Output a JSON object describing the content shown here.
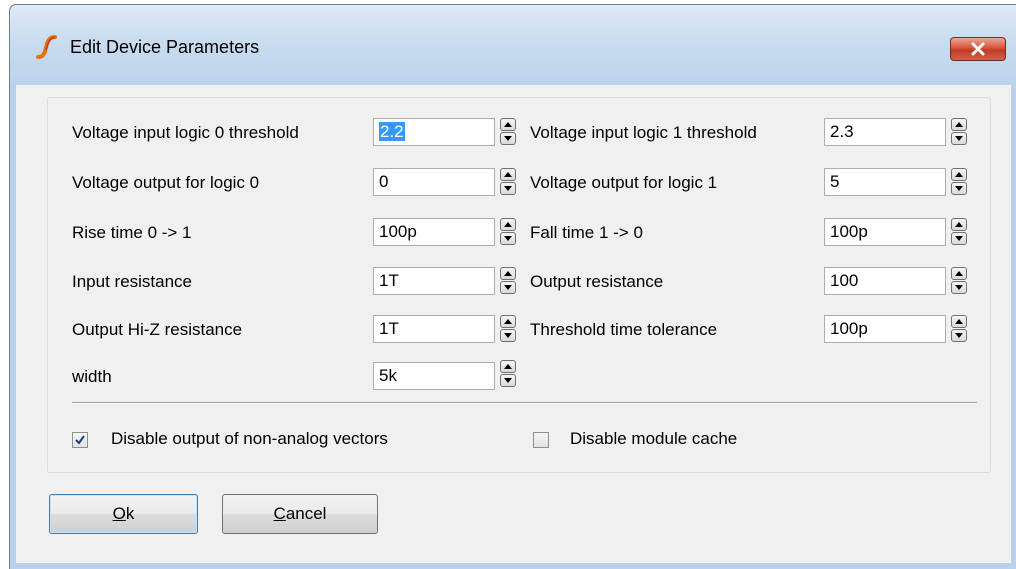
{
  "window": {
    "title": "Edit Device Parameters"
  },
  "params": {
    "left": [
      {
        "label": "Voltage input logic 0 threshold",
        "value": "2.2",
        "selected": true
      },
      {
        "label": "Voltage output for logic 0",
        "value": "0"
      },
      {
        "label": "Rise time 0 -> 1",
        "value": "100p"
      },
      {
        "label": "Input resistance",
        "value": "1T"
      },
      {
        "label": "Output Hi-Z resistance",
        "value": "1T"
      },
      {
        "label": "width",
        "value": "5k"
      }
    ],
    "right": [
      {
        "label": "Voltage input logic 1 threshold",
        "value": "2.3"
      },
      {
        "label": "Voltage output for logic 1",
        "value": "5"
      },
      {
        "label": "Fall time 1 -> 0",
        "value": "100p"
      },
      {
        "label": "Output resistance",
        "value": "100"
      },
      {
        "label": "Threshold time tolerance",
        "value": "100p"
      }
    ]
  },
  "options": {
    "disable_output_label": "Disable output of non-analog vectors",
    "disable_output_checked": true,
    "disable_cache_label": "Disable module cache",
    "disable_cache_checked": false
  },
  "buttons": {
    "ok_mnemonic": "O",
    "ok_rest": "k",
    "cancel_mnemonic": "C",
    "cancel_rest": "ancel"
  },
  "colors": {
    "accent_selection": "#3399ff",
    "app_icon_orange": "#e8730c"
  },
  "icons": {
    "app": "simetrix-logo-icon",
    "close": "close-icon",
    "spin": "spin-up-down-icon",
    "check": "checkmark-icon"
  }
}
